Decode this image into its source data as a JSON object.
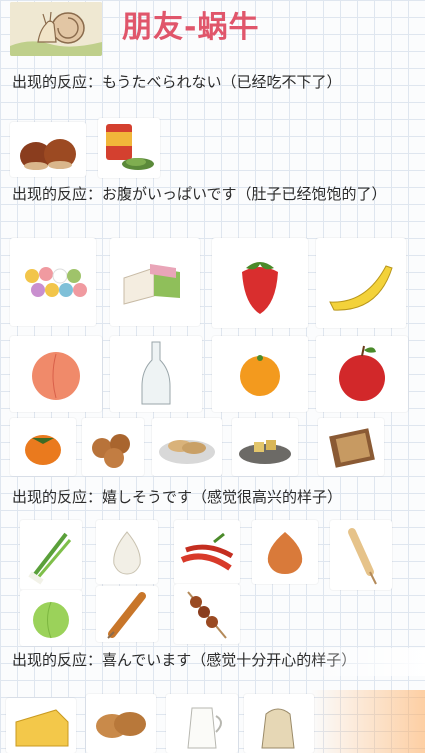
{
  "title": "朋友-蜗牛",
  "sections": [
    {
      "label": "出现的反应：もうたべられない（已经吃不下了）"
    },
    {
      "label": "出现的反应：お腹がいっぱいです（肚子已经饱饱的了）"
    },
    {
      "label": "出现的反应：嬉しそうです（感觉很高兴的样子）"
    },
    {
      "label": "出现的反应：喜んでいます（感觉十分开心的样子）"
    }
  ],
  "icons": {
    "section1": [
      "chestnuts-icon",
      "canned-food-icon"
    ],
    "section2_row1": [
      "dango-icon",
      "mochi-icon",
      "strawberry-icon",
      "banana-icon"
    ],
    "section2_row2": [
      "peach-icon",
      "bottle-icon",
      "orange-icon",
      "apple-icon"
    ],
    "section2_row3": [
      "persimmon-icon",
      "cookies-icon",
      "biscuit-plate-icon",
      "fried-food-plate-icon",
      "letter-icon"
    ],
    "section3_row1": [
      "green-onion-icon",
      "garlic-icon",
      "chili-peppers-icon",
      "onion-icon",
      "corn-dog-icon"
    ],
    "section3_row2": [
      "cabbage-icon",
      "grilled-corn-icon",
      "yakitori-skewer-icon"
    ],
    "section4": [
      "cheese-icon",
      "bread-rolls-icon",
      "milk-jug-icon",
      "rice-bag-icon"
    ]
  }
}
